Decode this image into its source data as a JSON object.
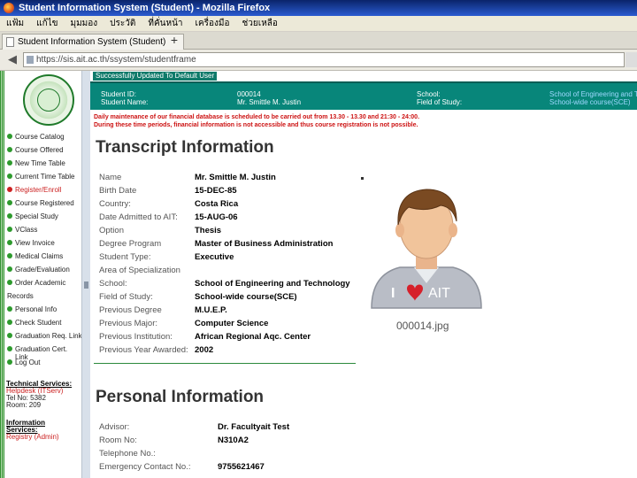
{
  "window": {
    "title": "Student Information System (Student) - Mozilla Firefox"
  },
  "menubar": [
    "แฟ้ม",
    "แก้ไข",
    "มุมมอง",
    "ประวัติ",
    "ที่คั่นหน้า",
    "เครื่องมือ",
    "ช่วยเหลือ"
  ],
  "tab": {
    "title": "Student Information System (Student)",
    "new_tab": "+"
  },
  "nav": {
    "url": "https://sis.ait.ac.th/ssystem/studentframe"
  },
  "sidebar": {
    "items": [
      {
        "label": "Course Catalog",
        "bullet": "green"
      },
      {
        "label": "Course Offered",
        "bullet": "green"
      },
      {
        "label": "New Time Table",
        "bullet": "green"
      },
      {
        "label": "Current Time Table",
        "bullet": "green"
      },
      {
        "label": "Register/Enroll",
        "bullet": "red",
        "active": true
      },
      {
        "label": "Course Registered",
        "bullet": "green"
      },
      {
        "label": "Special Study",
        "bullet": "green"
      },
      {
        "label": "VClass",
        "bullet": "green"
      },
      {
        "label": "View Invoice",
        "bullet": "green"
      },
      {
        "label": "Medical Claims",
        "bullet": "green"
      },
      {
        "label": "Grade/Evaluation",
        "bullet": "green"
      },
      {
        "label": "Order Academic",
        "bullet": "green"
      },
      {
        "label": "Records",
        "bullet": "none"
      },
      {
        "label": "Personal Info",
        "bullet": "green"
      },
      {
        "label": "Check Student",
        "bullet": "green"
      },
      {
        "label": "Graduation Req. Link",
        "bullet": "green"
      },
      {
        "label": "Graduation Cert. Link",
        "bullet": "green"
      },
      {
        "label": "Log Out",
        "bullet": "green"
      }
    ],
    "technical": {
      "title": "Technical Services:",
      "line1": "Helpdesk (ITServ)",
      "line2": "Tel No: 5382",
      "line3": "Room: 209"
    },
    "information": {
      "title": "Information",
      "title2": "Services:",
      "line1": "Registry (Admin)"
    }
  },
  "status": {
    "message": "Successfully Updated To Default User"
  },
  "student_band": {
    "id_label": "Student ID:",
    "id_value": "000014",
    "name_label": "Student Name:",
    "name_value": "Mr. Smittle M. Justin",
    "school_label": "School:",
    "field_label": "Field of Study:",
    "school_value": "School of Engineering and Technology",
    "field_value": "School-wide course(SCE)"
  },
  "notice": {
    "line1": "Daily maintenance of our financial database is scheduled to be carried out from 13.30 - 13.30 and 21:30 - 24:00.",
    "line2": "During these time periods, financial information is not accessible and thus course registration is not possible."
  },
  "transcript": {
    "title": "Transcript Information",
    "rows": [
      {
        "label": "Name",
        "value": "Mr. Smittle M. Justin"
      },
      {
        "label": "Birth Date",
        "value": "15-DEC-85"
      },
      {
        "label": "Country:",
        "value": "Costa Rica"
      },
      {
        "label": "Date Admitted to AIT:",
        "value": "15-AUG-06"
      },
      {
        "label": "Option",
        "value": "Thesis"
      },
      {
        "label": "Degree Program",
        "value": "Master of Business Administration"
      },
      {
        "label": "Student Type:",
        "value": "Executive"
      },
      {
        "label": "Area of Specialization",
        "value": ""
      },
      {
        "label": "School:",
        "value": "School of Engineering and Technology"
      },
      {
        "label": "Field of Study:",
        "value": "School-wide course(SCE)"
      },
      {
        "label": "Previous Degree",
        "value": "M.U.E.P."
      },
      {
        "label": "Previous Major:",
        "value": "Computer Science"
      },
      {
        "label": "Previous Institution:",
        "value": "African Regional Aqc. Center"
      },
      {
        "label": "Previous Year Awarded:",
        "value": "2002"
      }
    ]
  },
  "photo": {
    "shirt_text_i": "I",
    "shirt_text_ait": "AIT",
    "caption": "000014.jpg"
  },
  "personal": {
    "title": "Personal Information",
    "rows": [
      {
        "label": "Advisor:",
        "value": "Dr. Facultyait Test"
      },
      {
        "label": "Room No:",
        "value": "N310A2"
      },
      {
        "label": "Telephone No.:",
        "value": ""
      },
      {
        "label": "Emergency Contact No.:",
        "value": "9755621467"
      }
    ]
  },
  "colors": {
    "band": "#08867a",
    "accent_green": "#2d9a2d",
    "notice_red": "#cc1111",
    "titlebar": "#0a246a"
  }
}
